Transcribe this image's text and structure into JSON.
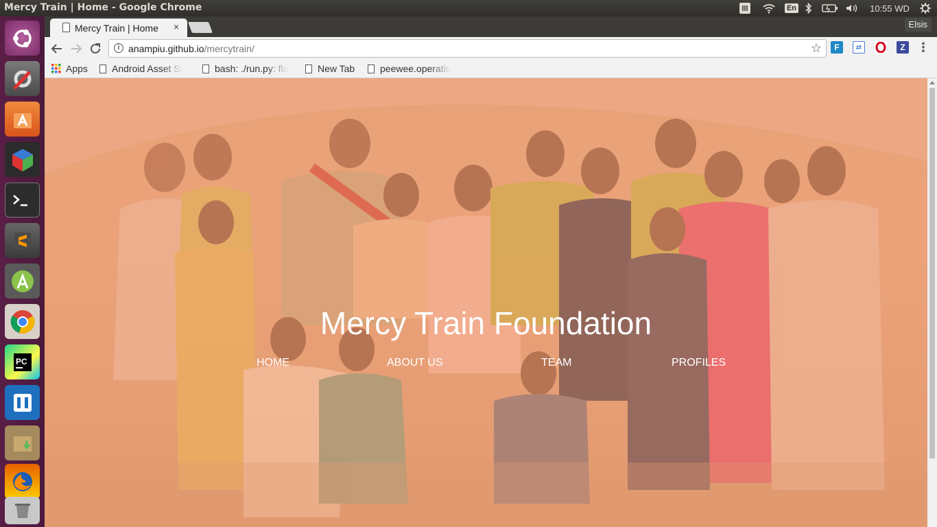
{
  "system_bar": {
    "window_title": "Mercy Train | Home - Google Chrome",
    "keyboard_layout": "En",
    "clock": "10:55 WD",
    "icons": [
      "keyboard-indicator-icon",
      "wifi-icon",
      "keyboard-layout-icon",
      "bluetooth-icon",
      "battery-icon",
      "volume-icon",
      "session-gear-icon"
    ]
  },
  "launcher": {
    "items": [
      "ubuntu-dash",
      "system-settings",
      "software-center",
      "cube-app",
      "terminal",
      "sublime-text",
      "android-studio",
      "chrome",
      "pycharm",
      "remmina",
      "archive-manager",
      "firefox",
      "trash"
    ]
  },
  "browser": {
    "tab_title": "Mercy Train | Home",
    "tab_close": "×",
    "profile_name": "Elsis",
    "url_host": "anampiu.github.io",
    "url_path": "/mercytrain/",
    "bookmarks": [
      {
        "label": "Apps"
      },
      {
        "label": "Android Asset St"
      },
      {
        "label": "bash: ./run.py: fla"
      },
      {
        "label": "New Tab"
      },
      {
        "label": "peewee.operatio"
      }
    ]
  },
  "page": {
    "hero_title": "Mercy Train Foundation",
    "nav": [
      "HOME",
      "ABOUT US",
      "TEAM",
      "PROFILES"
    ]
  },
  "colors": {
    "overlay_orange": "#f4a070",
    "launcher_purple": "#4e1b40"
  }
}
